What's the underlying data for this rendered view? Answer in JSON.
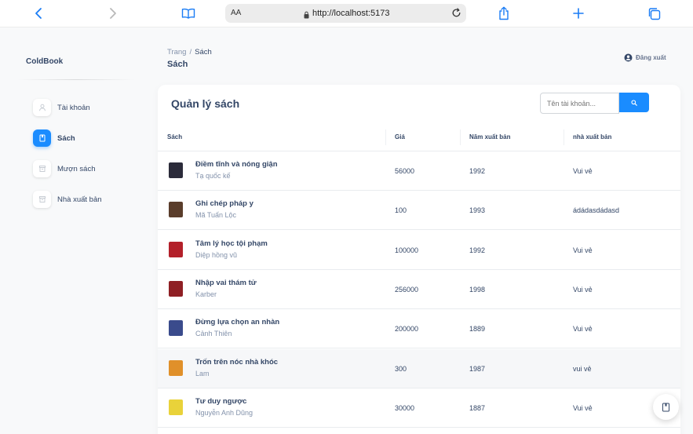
{
  "browser": {
    "reader_label": "AA",
    "url": "http://localhost:5173"
  },
  "sidebar": {
    "brand": "ColdBook",
    "items": [
      {
        "label": "Tài khoản",
        "icon": "user-icon",
        "active": false
      },
      {
        "label": "Sách",
        "icon": "book-icon",
        "active": true
      },
      {
        "label": "Mượn sách",
        "icon": "archive-icon",
        "active": false
      },
      {
        "label": "Nhà xuất bản",
        "icon": "archive-icon",
        "active": false
      }
    ]
  },
  "header": {
    "breadcrumb_root": "Trang",
    "breadcrumb_sep": "/",
    "breadcrumb_current": "Sách",
    "page_title": "Sách",
    "logout_label": "Đăng xuất"
  },
  "card": {
    "title": "Quản lý sách",
    "search_placeholder": "Tên tài khoản..."
  },
  "table": {
    "columns": [
      "Sách",
      "Giá",
      "Năm xuất bản",
      "nhà xuất bản"
    ],
    "rows": [
      {
        "title": "Điềm tĩnh và nóng giận",
        "author": "Tạ quốc kế",
        "price": "56000",
        "year": "1992",
        "publisher": "Vui vẻ",
        "thumb_color": "#2b2b3a",
        "highlight": false
      },
      {
        "title": "Ghi chép pháp y",
        "author": "Mã Tuấn Lộc",
        "price": "100",
        "year": "1993",
        "publisher": "ádádasdádasd",
        "thumb_color": "#5a3d2b",
        "highlight": false
      },
      {
        "title": "Tâm lý học tội phạm",
        "author": "Diệp hồng vũ",
        "price": "100000",
        "year": "1992",
        "publisher": "Vui vẻ",
        "thumb_color": "#b3202a",
        "highlight": false
      },
      {
        "title": "Nhập vai thám tử",
        "author": "Karber",
        "price": "256000",
        "year": "1998",
        "publisher": "Vui vẻ",
        "thumb_color": "#8f1f24",
        "highlight": false
      },
      {
        "title": "Đừng lựa chọn an nhàn",
        "author": "Cảnh Thiên",
        "price": "200000",
        "year": "1889",
        "publisher": "Vui vẻ",
        "thumb_color": "#3a4b8c",
        "highlight": false
      },
      {
        "title": "Trốn trên nóc nhà khóc",
        "author": "Lam",
        "price": "300",
        "year": "1987",
        "publisher": "vui vẻ",
        "thumb_color": "#e0902a",
        "highlight": true
      },
      {
        "title": "Tư duy ngược",
        "author": "Nguyễn Anh Dũng",
        "price": "30000",
        "year": "1887",
        "publisher": "Vui vẻ",
        "thumb_color": "#e9d23a",
        "highlight": false
      }
    ]
  },
  "colors": {
    "accent": "#1a8cff",
    "text_primary": "#344767",
    "text_secondary": "#8392ab"
  }
}
